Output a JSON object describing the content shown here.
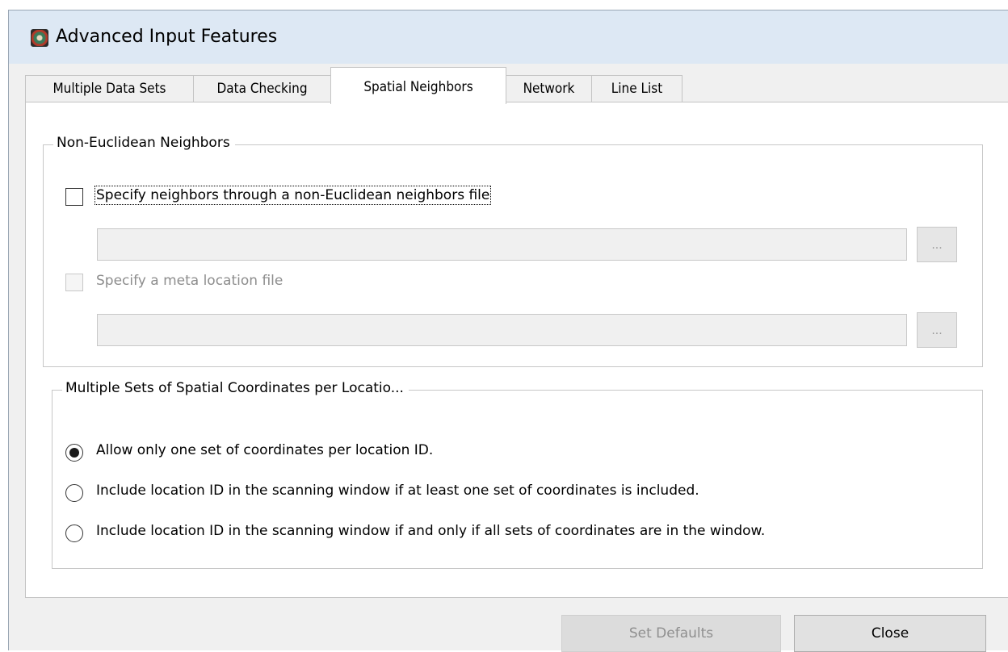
{
  "window": {
    "title": "Advanced Input Features",
    "icon": "satscan-app-icon"
  },
  "tabs": [
    {
      "label": "Multiple Data Sets",
      "active": false
    },
    {
      "label": "Data Checking",
      "active": false
    },
    {
      "label": "Spatial Neighbors",
      "active": true
    },
    {
      "label": "Network",
      "active": false
    },
    {
      "label": "Line List",
      "active": false
    }
  ],
  "non_euclidean": {
    "legend": "Non-Euclidean Neighbors",
    "neighbors_checkbox_label": "Specify neighbors through a non-Euclidean neighbors file",
    "neighbors_checked": false,
    "neighbors_file_value": "",
    "neighbors_browse_label": "...",
    "meta_checkbox_label": "Specify a meta location file",
    "meta_checked": false,
    "meta_file_value": "",
    "meta_browse_label": "..."
  },
  "coordinates": {
    "legend": "Multiple Sets of Spatial Coordinates per Locatio...",
    "options": [
      {
        "label": "Allow only one set of coordinates per location ID.",
        "selected": true
      },
      {
        "label": "Include location ID in the scanning window if at least one set of coordinates is included.",
        "selected": false
      },
      {
        "label": "Include location ID in the scanning window if and only if all sets of coordinates are in the window.",
        "selected": false
      }
    ]
  },
  "footer": {
    "set_defaults_label": "Set Defaults",
    "close_label": "Close"
  }
}
